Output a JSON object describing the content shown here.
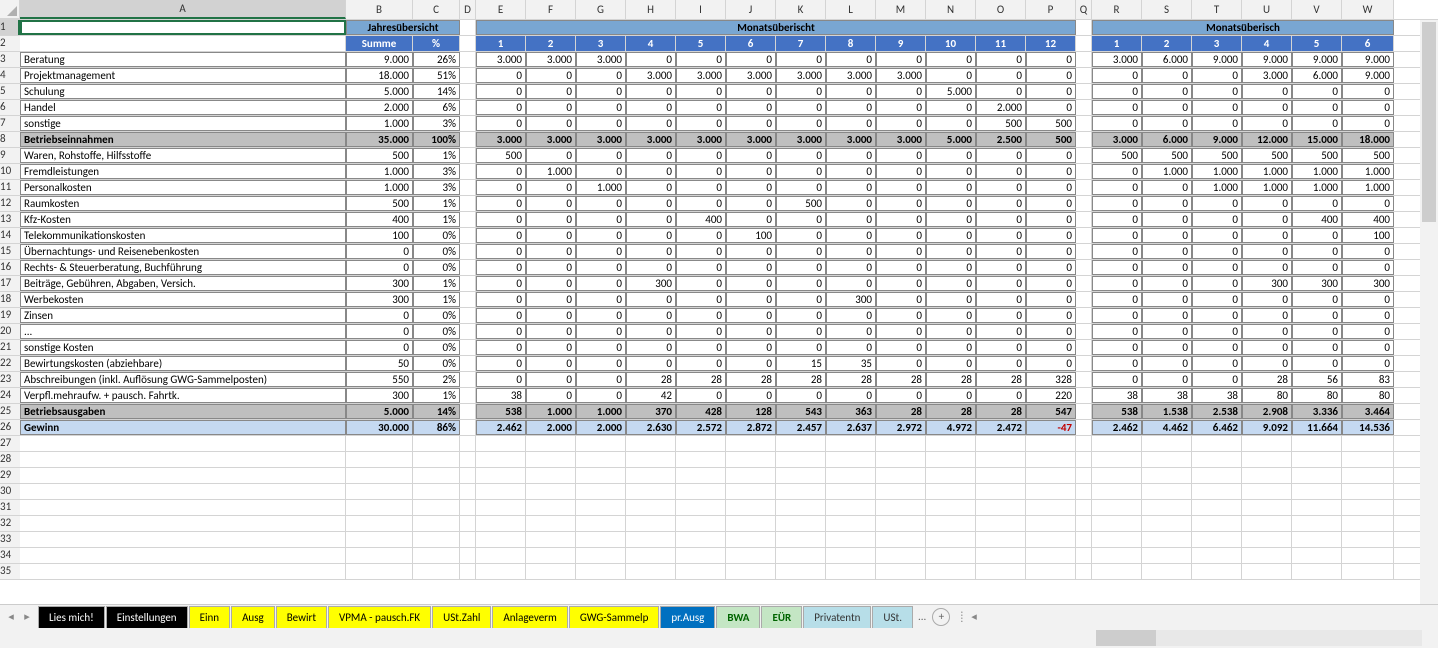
{
  "columns": [
    "A",
    "B",
    "C",
    "D",
    "E",
    "F",
    "G",
    "H",
    "I",
    "J",
    "K",
    "L",
    "M",
    "N",
    "O",
    "P",
    "Q",
    "R",
    "S",
    "T",
    "U",
    "V",
    "W"
  ],
  "col_widths": {
    "A": 326,
    "B": 67,
    "C": 47,
    "D": 16,
    "E": 50,
    "F": 50,
    "G": 50,
    "H": 50,
    "I": 50,
    "J": 50,
    "K": 50,
    "L": 50,
    "M": 50,
    "N": 50,
    "O": 50,
    "P": 50,
    "Q": 16,
    "R": 50,
    "S": 50,
    "T": 50,
    "U": 50,
    "V": 50,
    "W": 52
  },
  "headers": {
    "jahres": "Jahresübersicht",
    "monats1": "Monatsüberischt",
    "monats2": "Monatsüberisch",
    "summe": "Summe",
    "pct": "%"
  },
  "month_nums_1": [
    "1",
    "2",
    "3",
    "4",
    "5",
    "6",
    "7",
    "8",
    "9",
    "10",
    "11",
    "12"
  ],
  "month_nums_2": [
    "1",
    "2",
    "3",
    "4",
    "5",
    "6"
  ],
  "rows": [
    {
      "n": 3,
      "label": "Beratung",
      "sum": "9.000",
      "pct": "26%",
      "m": [
        "3.000",
        "3.000",
        "3.000",
        "0",
        "0",
        "0",
        "0",
        "0",
        "0",
        "0",
        "0",
        "0"
      ],
      "c": [
        "3.000",
        "6.000",
        "9.000",
        "9.000",
        "9.000",
        "9.000"
      ]
    },
    {
      "n": 4,
      "label": "Projektmanagement",
      "sum": "18.000",
      "pct": "51%",
      "m": [
        "0",
        "0",
        "0",
        "3.000",
        "3.000",
        "3.000",
        "3.000",
        "3.000",
        "3.000",
        "0",
        "0",
        "0"
      ],
      "c": [
        "0",
        "0",
        "0",
        "3.000",
        "6.000",
        "9.000"
      ]
    },
    {
      "n": 5,
      "label": "Schulung",
      "sum": "5.000",
      "pct": "14%",
      "m": [
        "0",
        "0",
        "0",
        "0",
        "0",
        "0",
        "0",
        "0",
        "0",
        "5.000",
        "0",
        "0"
      ],
      "c": [
        "0",
        "0",
        "0",
        "0",
        "0",
        "0"
      ]
    },
    {
      "n": 6,
      "label": "Handel",
      "sum": "2.000",
      "pct": "6%",
      "m": [
        "0",
        "0",
        "0",
        "0",
        "0",
        "0",
        "0",
        "0",
        "0",
        "0",
        "2.000",
        "0"
      ],
      "c": [
        "0",
        "0",
        "0",
        "0",
        "0",
        "0"
      ]
    },
    {
      "n": 7,
      "label": "sonstige",
      "sum": "1.000",
      "pct": "3%",
      "m": [
        "0",
        "0",
        "0",
        "0",
        "0",
        "0",
        "0",
        "0",
        "0",
        "0",
        "500",
        "500"
      ],
      "c": [
        "0",
        "0",
        "0",
        "0",
        "0",
        "0"
      ]
    },
    {
      "n": 8,
      "label": "Betriebseinnahmen",
      "sum": "35.000",
      "pct": "100%",
      "m": [
        "3.000",
        "3.000",
        "3.000",
        "3.000",
        "3.000",
        "3.000",
        "3.000",
        "3.000",
        "3.000",
        "5.000",
        "2.500",
        "500"
      ],
      "c": [
        "3.000",
        "6.000",
        "9.000",
        "12.000",
        "15.000",
        "18.000"
      ],
      "style": "total"
    },
    {
      "n": 9,
      "label": "Waren, Rohstoffe, Hilfsstoffe",
      "sum": "500",
      "pct": "1%",
      "m": [
        "500",
        "0",
        "0",
        "0",
        "0",
        "0",
        "0",
        "0",
        "0",
        "0",
        "0",
        "0"
      ],
      "c": [
        "500",
        "500",
        "500",
        "500",
        "500",
        "500"
      ]
    },
    {
      "n": 10,
      "label": "Fremdleistungen",
      "sum": "1.000",
      "pct": "3%",
      "m": [
        "0",
        "1.000",
        "0",
        "0",
        "0",
        "0",
        "0",
        "0",
        "0",
        "0",
        "0",
        "0"
      ],
      "c": [
        "0",
        "1.000",
        "1.000",
        "1.000",
        "1.000",
        "1.000"
      ]
    },
    {
      "n": 11,
      "label": "Personalkosten",
      "sum": "1.000",
      "pct": "3%",
      "m": [
        "0",
        "0",
        "1.000",
        "0",
        "0",
        "0",
        "0",
        "0",
        "0",
        "0",
        "0",
        "0"
      ],
      "c": [
        "0",
        "0",
        "1.000",
        "1.000",
        "1.000",
        "1.000"
      ]
    },
    {
      "n": 12,
      "label": "Raumkosten",
      "sum": "500",
      "pct": "1%",
      "m": [
        "0",
        "0",
        "0",
        "0",
        "0",
        "0",
        "500",
        "0",
        "0",
        "0",
        "0",
        "0"
      ],
      "c": [
        "0",
        "0",
        "0",
        "0",
        "0",
        "0"
      ]
    },
    {
      "n": 13,
      "label": "Kfz-Kosten",
      "sum": "400",
      "pct": "1%",
      "m": [
        "0",
        "0",
        "0",
        "0",
        "400",
        "0",
        "0",
        "0",
        "0",
        "0",
        "0",
        "0"
      ],
      "c": [
        "0",
        "0",
        "0",
        "0",
        "400",
        "400"
      ]
    },
    {
      "n": 14,
      "label": "Telekommunikationskosten",
      "sum": "100",
      "pct": "0%",
      "m": [
        "0",
        "0",
        "0",
        "0",
        "0",
        "100",
        "0",
        "0",
        "0",
        "0",
        "0",
        "0"
      ],
      "c": [
        "0",
        "0",
        "0",
        "0",
        "0",
        "100"
      ]
    },
    {
      "n": 15,
      "label": "Übernachtungs- und Reisenebenkosten",
      "sum": "0",
      "pct": "0%",
      "m": [
        "0",
        "0",
        "0",
        "0",
        "0",
        "0",
        "0",
        "0",
        "0",
        "0",
        "0",
        "0"
      ],
      "c": [
        "0",
        "0",
        "0",
        "0",
        "0",
        "0"
      ]
    },
    {
      "n": 16,
      "label": "Rechts- & Steuerberatung, Buchführung",
      "sum": "0",
      "pct": "0%",
      "m": [
        "0",
        "0",
        "0",
        "0",
        "0",
        "0",
        "0",
        "0",
        "0",
        "0",
        "0",
        "0"
      ],
      "c": [
        "0",
        "0",
        "0",
        "0",
        "0",
        "0"
      ]
    },
    {
      "n": 17,
      "label": "Beiträge, Gebühren, Abgaben, Versich.",
      "sum": "300",
      "pct": "1%",
      "m": [
        "0",
        "0",
        "0",
        "300",
        "0",
        "0",
        "0",
        "0",
        "0",
        "0",
        "0",
        "0"
      ],
      "c": [
        "0",
        "0",
        "0",
        "300",
        "300",
        "300"
      ]
    },
    {
      "n": 18,
      "label": "Werbekosten",
      "sum": "300",
      "pct": "1%",
      "m": [
        "0",
        "0",
        "0",
        "0",
        "0",
        "0",
        "0",
        "300",
        "0",
        "0",
        "0",
        "0"
      ],
      "c": [
        "0",
        "0",
        "0",
        "0",
        "0",
        "0"
      ]
    },
    {
      "n": 19,
      "label": "Zinsen",
      "sum": "0",
      "pct": "0%",
      "m": [
        "0",
        "0",
        "0",
        "0",
        "0",
        "0",
        "0",
        "0",
        "0",
        "0",
        "0",
        "0"
      ],
      "c": [
        "0",
        "0",
        "0",
        "0",
        "0",
        "0"
      ]
    },
    {
      "n": 20,
      "label": "...",
      "sum": "0",
      "pct": "0%",
      "m": [
        "0",
        "0",
        "0",
        "0",
        "0",
        "0",
        "0",
        "0",
        "0",
        "0",
        "0",
        "0"
      ],
      "c": [
        "0",
        "0",
        "0",
        "0",
        "0",
        "0"
      ]
    },
    {
      "n": 21,
      "label": "sonstige Kosten",
      "sum": "0",
      "pct": "0%",
      "m": [
        "0",
        "0",
        "0",
        "0",
        "0",
        "0",
        "0",
        "0",
        "0",
        "0",
        "0",
        "0"
      ],
      "c": [
        "0",
        "0",
        "0",
        "0",
        "0",
        "0"
      ]
    },
    {
      "n": 22,
      "label": "Bewirtungskosten (abziehbare)",
      "sum": "50",
      "pct": "0%",
      "m": [
        "0",
        "0",
        "0",
        "0",
        "0",
        "0",
        "15",
        "35",
        "0",
        "0",
        "0",
        "0"
      ],
      "c": [
        "0",
        "0",
        "0",
        "0",
        "0",
        "0"
      ]
    },
    {
      "n": 23,
      "label": "Abschreibungen (inkl. Auflösung GWG-Sammelposten)",
      "sum": "550",
      "pct": "2%",
      "m": [
        "0",
        "0",
        "0",
        "28",
        "28",
        "28",
        "28",
        "28",
        "28",
        "28",
        "28",
        "328"
      ],
      "c": [
        "0",
        "0",
        "0",
        "28",
        "56",
        "83"
      ]
    },
    {
      "n": 24,
      "label": "Verpfl.mehraufw. + pausch. Fahrtk.",
      "sum": "300",
      "pct": "1%",
      "m": [
        "38",
        "0",
        "0",
        "42",
        "0",
        "0",
        "0",
        "0",
        "0",
        "0",
        "0",
        "220"
      ],
      "c": [
        "38",
        "38",
        "38",
        "80",
        "80",
        "80"
      ]
    },
    {
      "n": 25,
      "label": "Betriebsausgaben",
      "sum": "5.000",
      "pct": "14%",
      "m": [
        "538",
        "1.000",
        "1.000",
        "370",
        "428",
        "128",
        "543",
        "363",
        "28",
        "28",
        "28",
        "547"
      ],
      "c": [
        "538",
        "1.538",
        "2.538",
        "2.908",
        "3.336",
        "3.464"
      ],
      "style": "total"
    },
    {
      "n": 26,
      "label": "Gewinn",
      "sum": "30.000",
      "pct": "86%",
      "m": [
        "2.462",
        "2.000",
        "2.000",
        "2.630",
        "2.572",
        "2.872",
        "2.457",
        "2.637",
        "2.972",
        "4.972",
        "2.472",
        "-47"
      ],
      "c": [
        "2.462",
        "4.462",
        "6.462",
        "9.092",
        "11.664",
        "14.536"
      ],
      "style": "gewinn"
    }
  ],
  "empty_rows": [
    27,
    28,
    29,
    30,
    31,
    32,
    33,
    34,
    35
  ],
  "tabs": [
    {
      "label": "Lies mich!",
      "cls": "black"
    },
    {
      "label": "Einstellungen",
      "cls": "black"
    },
    {
      "label": "Einn",
      "cls": "yellow"
    },
    {
      "label": "Ausg",
      "cls": "yellow"
    },
    {
      "label": "Bewirt",
      "cls": "yellow"
    },
    {
      "label": "VPMA - pausch.FK",
      "cls": "yellow"
    },
    {
      "label": "USt.Zahl",
      "cls": "yellow"
    },
    {
      "label": "Anlageverm",
      "cls": "yellow"
    },
    {
      "label": "GWG-Sammelp",
      "cls": "yellow"
    },
    {
      "label": "pr.Ausg",
      "cls": "blue"
    },
    {
      "label": "BWA",
      "cls": "green"
    },
    {
      "label": "EÜR",
      "cls": "green"
    },
    {
      "label": "Privatentn",
      "cls": "teal"
    },
    {
      "label": "USt.",
      "cls": "teal"
    }
  ],
  "tab_more": "...",
  "nav": {
    "first": "◀",
    "prev": "▶"
  }
}
